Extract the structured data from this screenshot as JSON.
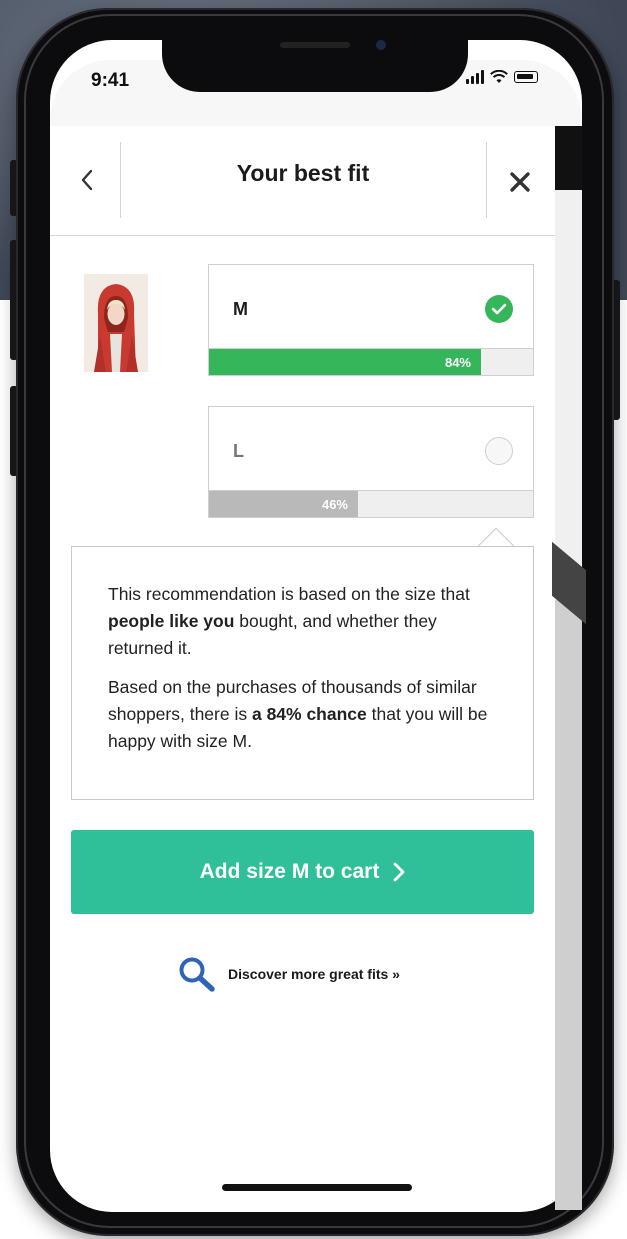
{
  "status_bar": {
    "time": "9:41"
  },
  "header": {
    "title": "Your best fit",
    "back_icon": "chevron-left-icon",
    "close_icon": "close-icon"
  },
  "product": {
    "image": "model-in-red-hooded-cardigan"
  },
  "sizes": [
    {
      "label": "M",
      "percent_label": "84%",
      "fit_percent": 84,
      "selected": true
    },
    {
      "label": "L",
      "percent_label": "46%",
      "fit_percent": 46,
      "selected": false
    }
  ],
  "info": {
    "p1_a": "This recommendation is based on the size that ",
    "p1_b": "people like you",
    "p1_c": " bought, and whether they returned it.",
    "p2_a": "Based on the purchases of thousands of similar shoppers, there is ",
    "p2_b": "a 84% chance",
    "p2_c": " that you will be happy with size M."
  },
  "cart_button": {
    "label": "Add size M to cart",
    "icon": "chevron-right-icon"
  },
  "discover": {
    "label": "Discover more great fits »",
    "icon": "search-icon"
  },
  "colors": {
    "accent_green": "#36b65a",
    "cta_teal": "#2fbf99",
    "inactive_grey": "#b9b9b9"
  }
}
